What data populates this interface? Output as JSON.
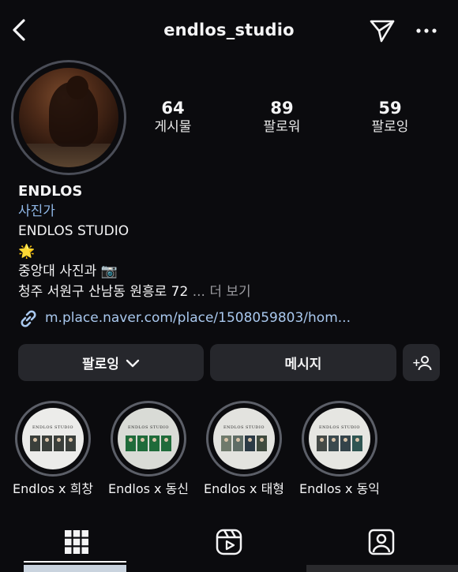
{
  "header": {
    "handle": "endlos_studio",
    "back_icon": "chevron-left-icon",
    "send_icon": "paper-plane-icon",
    "more_icon": "ellipsis-icon"
  },
  "stats": [
    {
      "value": "64",
      "label": "게시물"
    },
    {
      "value": "89",
      "label": "팔로워"
    },
    {
      "value": "59",
      "label": "팔로잉"
    }
  ],
  "bio": {
    "name": "ENDLOS",
    "category": "사진가",
    "line1": "ENDLOS STUDIO",
    "line2": "🌟",
    "line3": "중앙대 사진과 📷",
    "line4": "청주 서원구 산남동 원흥로 72",
    "more": "... 더 보기",
    "link": "m.place.naver.com/place/1508059803/hom..."
  },
  "actions": {
    "follow_label": "팔로잉",
    "message_label": "메시지",
    "add_person_label": "+"
  },
  "highlights": [
    {
      "label": "Endlos x 희창",
      "brand": "ENDLOS STUDIO"
    },
    {
      "label": "Endlos x 동신",
      "brand": "ENDLOS STUDIO"
    },
    {
      "label": "Endlos x 태형",
      "brand": "ENDLOS STUDIO"
    },
    {
      "label": "Endlos x 동익",
      "brand": "ENDLOS STUDIO"
    }
  ],
  "tabs": [
    {
      "icon": "grid-icon",
      "selected": true
    },
    {
      "icon": "reels-icon",
      "selected": false
    },
    {
      "icon": "tagged-user-icon",
      "selected": false
    }
  ],
  "colors": {
    "background": "#0b0b0e",
    "button": "#26272c",
    "link": "#a9c8ee",
    "category": "#8fb7e6"
  }
}
